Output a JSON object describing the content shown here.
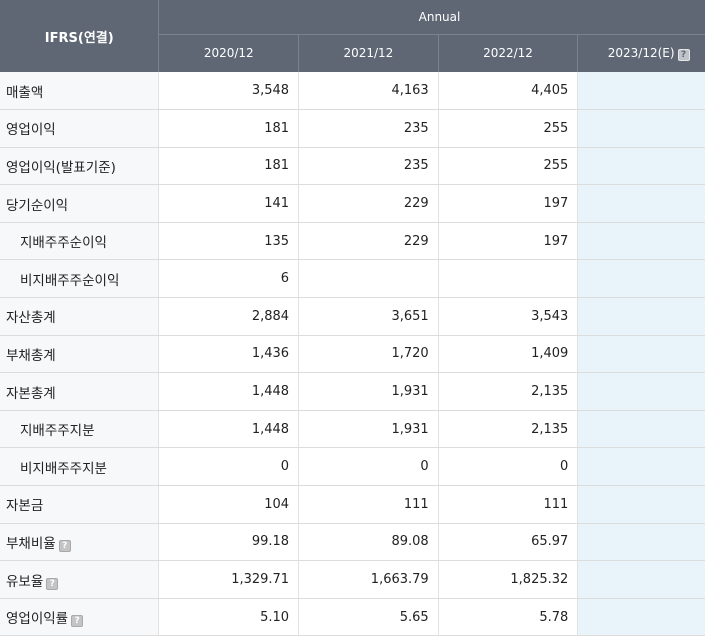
{
  "header": {
    "label_col": "IFRS(연결)",
    "group": "Annual",
    "periods": [
      "2020/12",
      "2021/12",
      "2022/12",
      "2023/12(E)"
    ]
  },
  "rows": [
    {
      "label": "매출액",
      "values": [
        "3,548",
        "4,163",
        "4,405",
        ""
      ]
    },
    {
      "label": "영업이익",
      "values": [
        "181",
        "235",
        "255",
        ""
      ]
    },
    {
      "label": "영업이익(발표기준)",
      "values": [
        "181",
        "235",
        "255",
        ""
      ]
    },
    {
      "label": "당기순이익",
      "values": [
        "141",
        "229",
        "197",
        ""
      ]
    },
    {
      "label": "지배주주순이익",
      "values": [
        "135",
        "229",
        "197",
        ""
      ]
    },
    {
      "label": "비지배주주순이익",
      "values": [
        "6",
        "",
        "",
        ""
      ]
    },
    {
      "label": "자산총계",
      "values": [
        "2,884",
        "3,651",
        "3,543",
        ""
      ]
    },
    {
      "label": "부채총계",
      "values": [
        "1,436",
        "1,720",
        "1,409",
        ""
      ]
    },
    {
      "label": "자본총계",
      "values": [
        "1,448",
        "1,931",
        "2,135",
        ""
      ]
    },
    {
      "label": "지배주주지분",
      "values": [
        "1,448",
        "1,931",
        "2,135",
        ""
      ]
    },
    {
      "label": "비지배주주지분",
      "values": [
        "0",
        "0",
        "0",
        ""
      ]
    },
    {
      "label": "자본금",
      "values": [
        "104",
        "111",
        "111",
        ""
      ]
    },
    {
      "label": "부채비율",
      "values": [
        "99.18",
        "89.08",
        "65.97",
        ""
      ]
    },
    {
      "label": "유보율",
      "values": [
        "1,329.71",
        "1,663.79",
        "1,825.32",
        ""
      ]
    },
    {
      "label": "영업이익률",
      "values": [
        "5.10",
        "5.65",
        "5.78",
        ""
      ]
    }
  ],
  "colors": {
    "header_bg": "#5f6775",
    "label_bg": "#f7f8fa",
    "estimate_bg": "#e8f3fa"
  },
  "icons": {
    "help": "help-icon"
  }
}
